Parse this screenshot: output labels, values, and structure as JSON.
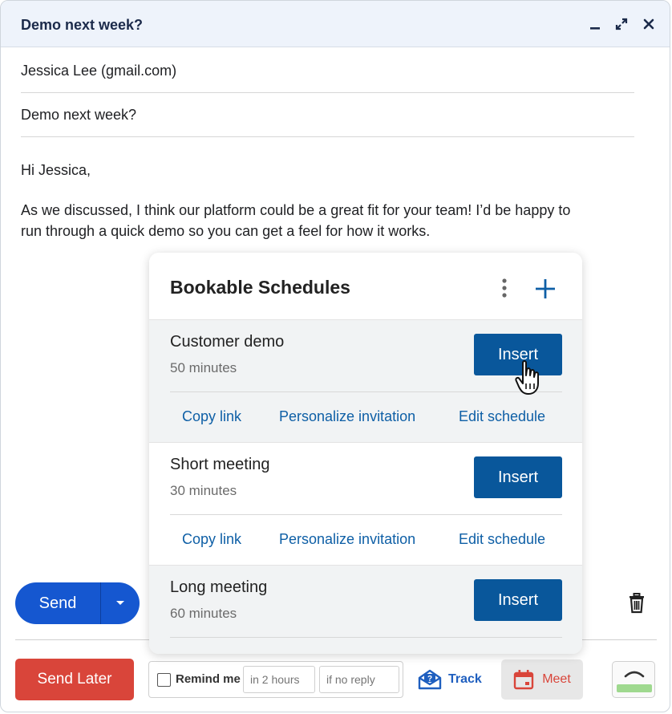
{
  "window": {
    "title": "Demo next week?"
  },
  "compose": {
    "to": "Jessica Lee (gmail.com)",
    "subject": "Demo next week?",
    "greeting": "Hi Jessica,",
    "paragraph_line1": "As we discussed, I think our platform could be a great fit for your team! I’d be happy to",
    "paragraph_line2": "run through a quick demo so you can get a feel for how it works."
  },
  "actions": {
    "send_label": "Send",
    "send_later_label": "Send Later",
    "remind_label": "Remind me",
    "remind_time_placeholder": "in 2 hours",
    "remind_condition_placeholder": "if no reply",
    "track_label": "Track",
    "meet_label": "Meet"
  },
  "bookable": {
    "title": "Bookable Schedules",
    "schedules": [
      {
        "name": "Customer demo",
        "duration": "50 minutes",
        "insert_label": "Insert",
        "copy_link": "Copy link",
        "personalize": "Personalize invitation",
        "edit": "Edit schedule"
      },
      {
        "name": "Short meeting",
        "duration": "30 minutes",
        "insert_label": "Insert",
        "copy_link": "Copy link",
        "personalize": "Personalize invitation",
        "edit": "Edit schedule"
      },
      {
        "name": "Long meeting",
        "duration": "60 minutes",
        "insert_label": "Insert"
      }
    ]
  },
  "colors": {
    "send_blue": "#1557d0",
    "send_later_red": "#d9453a",
    "insert_blue": "#09579b",
    "link_blue": "#0e5fa6",
    "titlebar_bg": "#eef3fb"
  },
  "icons": {
    "minimize": "minimize-icon",
    "expand": "expand-icon",
    "close": "close-icon",
    "send_options": "chevron-down-icon",
    "trash": "trash-icon",
    "track": "envelope-question-icon",
    "meet": "calendar-icon",
    "more": "kebab-menu-icon",
    "add": "plus-icon",
    "cursor": "hand-pointer-icon"
  }
}
